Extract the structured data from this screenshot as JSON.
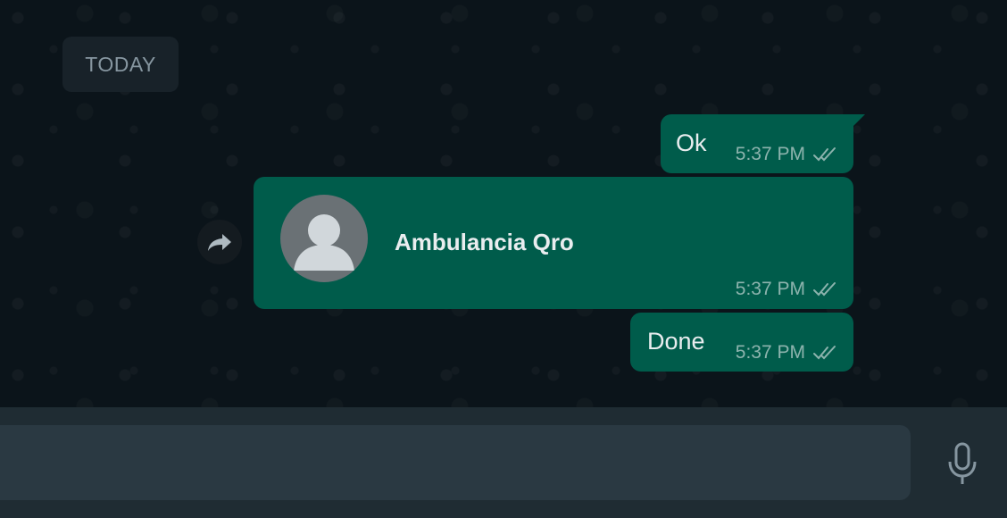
{
  "chat": {
    "date_label": "TODAY",
    "messages": [
      {
        "type": "text",
        "text": "Ok",
        "time": "5:37 PM",
        "status": "read"
      },
      {
        "type": "contact",
        "contact_name": "Ambulancia Qro",
        "time": "5:37 PM",
        "status": "read"
      },
      {
        "type": "text",
        "text": "Done",
        "time": "5:37 PM",
        "status": "read"
      }
    ]
  },
  "composer": {
    "placeholder": ""
  },
  "icons": {
    "forward": "forward-icon",
    "read_receipt": "double-check-icon",
    "microphone": "microphone-icon",
    "avatar": "default-avatar-icon"
  },
  "colors": {
    "outgoing_bubble": "#005c4b",
    "chat_background": "#0b141a",
    "date_chip": "#182229",
    "composer_bar": "#1f2c33",
    "input_field": "#2a3942"
  }
}
